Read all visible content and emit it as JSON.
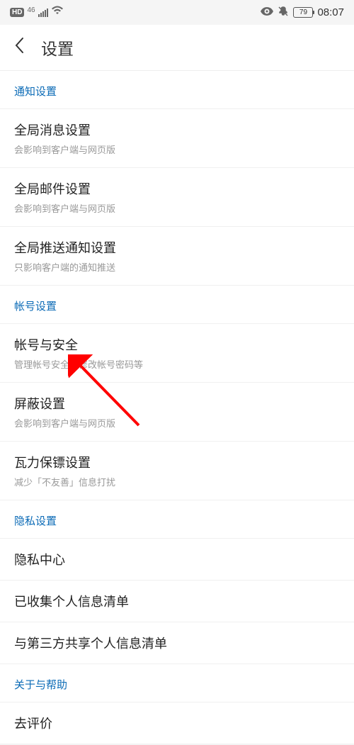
{
  "statusBar": {
    "hdLabel": "HD",
    "networkLabel": "46",
    "battery": "79",
    "time": "08:07"
  },
  "header": {
    "title": "设置"
  },
  "sections": [
    {
      "header": "通知设置",
      "items": [
        {
          "title": "全局消息设置",
          "desc": "会影响到客户端与网页版"
        },
        {
          "title": "全局邮件设置",
          "desc": "会影响到客户端与网页版"
        },
        {
          "title": "全局推送通知设置",
          "desc": "只影响客户端的通知推送"
        }
      ]
    },
    {
      "header": "帐号设置",
      "items": [
        {
          "title": "帐号与安全",
          "desc": "管理帐号安全，修改帐号密码等"
        },
        {
          "title": "屏蔽设置",
          "desc": "会影响到客户端与网页版"
        },
        {
          "title": "瓦力保镖设置",
          "desc": "减少「不友善」信息打扰"
        }
      ]
    },
    {
      "header": "隐私设置",
      "items": [
        {
          "title": "隐私中心",
          "desc": ""
        },
        {
          "title": "已收集个人信息清单",
          "desc": ""
        },
        {
          "title": "与第三方共享个人信息清单",
          "desc": ""
        }
      ]
    },
    {
      "header": "关于与帮助",
      "items": [
        {
          "title": "去评价",
          "desc": ""
        }
      ]
    }
  ]
}
